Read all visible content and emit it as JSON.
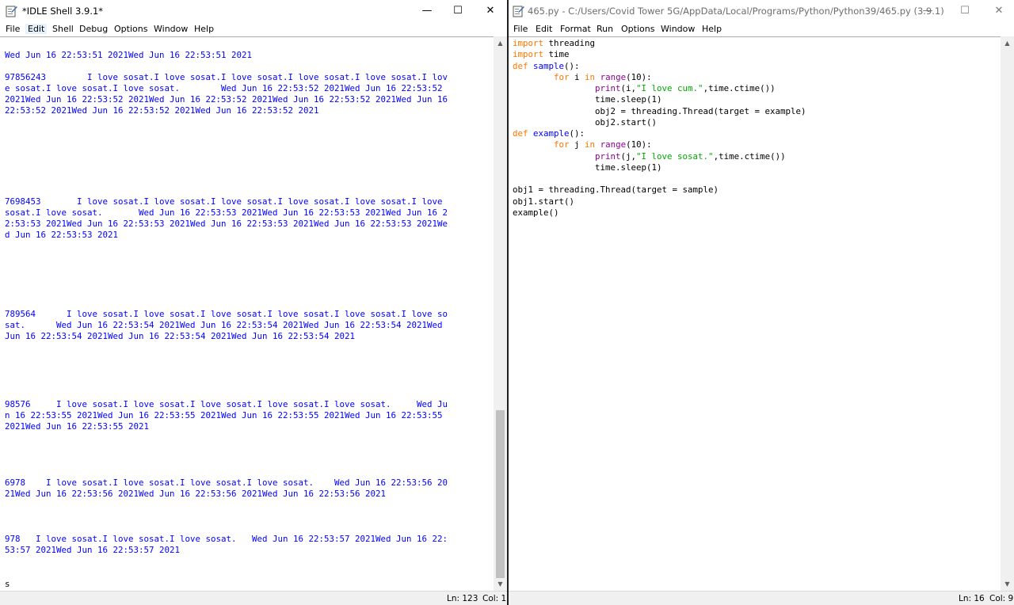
{
  "shell": {
    "title": "*IDLE Shell 3.9.1*",
    "menu": [
      "File",
      "Edit",
      "Shell",
      "Debug",
      "Options",
      "Window",
      "Help"
    ],
    "active_menu": "Edit",
    "output_lines": [
      "Wed Jun 16 22:53:51 2021Wed Jun 16 22:53:51 2021",
      "97856243        I love sosat.I love sosat.I love sosat.I love sosat.I love sosat.I lov",
      "e sosat.I love sosat.I love sosat.        Wed Jun 16 22:53:52 2021Wed Jun 16 22:53:52",
      "2021Wed Jun 16 22:53:52 2021Wed Jun 16 22:53:52 2021Wed Jun 16 22:53:52 2021Wed Jun 16",
      "22:53:52 2021Wed Jun 16 22:53:52 2021Wed Jun 16 22:53:52 2021",
      "7698453       I love sosat.I love sosat.I love sosat.I love sosat.I love sosat.I love",
      "sosat.I love sosat.       Wed Jun 16 22:53:53 2021Wed Jun 16 22:53:53 2021Wed Jun 16 2",
      "2:53:53 2021Wed Jun 16 22:53:53 2021Wed Jun 16 22:53:53 2021Wed Jun 16 22:53:53 2021We",
      "d Jun 16 22:53:53 2021",
      "789564      I love sosat.I love sosat.I love sosat.I love sosat.I love sosat.I love so",
      "sat.      Wed Jun 16 22:53:54 2021Wed Jun 16 22:53:54 2021Wed Jun 16 22:53:54 2021Wed",
      "Jun 16 22:53:54 2021Wed Jun 16 22:53:54 2021Wed Jun 16 22:53:54 2021",
      "98576     I love sosat.I love sosat.I love sosat.I love sosat.I love sosat.     Wed Ju",
      "n 16 22:53:55 2021Wed Jun 16 22:53:55 2021Wed Jun 16 22:53:55 2021Wed Jun 16 22:53:55",
      "2021Wed Jun 16 22:53:55 2021",
      "6978    I love sosat.I love sosat.I love sosat.I love sosat.    Wed Jun 16 22:53:56 20",
      "21Wed Jun 16 22:53:56 2021Wed Jun 16 22:53:56 2021Wed Jun 16 22:53:56 2021",
      "978   I love sosat.I love sosat.I love sosat.   Wed Jun 16 22:53:57 2021Wed Jun 16 22:",
      "53:57 2021Wed Jun 16 22:53:57 2021",
      "s"
    ],
    "status": {
      "line": "Ln: 123",
      "col": "Col: 1"
    }
  },
  "editor": {
    "title": "465.py - C:/Users/Covid Tower 5G/AppData/Local/Programs/Python/Python39/465.py (3.9.1)",
    "menu": [
      "File",
      "Edit",
      "Format",
      "Run",
      "Options",
      "Window",
      "Help"
    ],
    "code_lines": [
      [
        {
          "t": "import",
          "c": "kw"
        },
        {
          "t": " threading",
          "c": "pl"
        }
      ],
      [
        {
          "t": "import",
          "c": "kw"
        },
        {
          "t": " time",
          "c": "pl"
        }
      ],
      [
        {
          "t": "def",
          "c": "kw"
        },
        {
          "t": " ",
          "c": "pl"
        },
        {
          "t": "sample",
          "c": "df"
        },
        {
          "t": "():",
          "c": "pl"
        }
      ],
      [
        {
          "t": "        ",
          "c": "pl"
        },
        {
          "t": "for",
          "c": "kw"
        },
        {
          "t": " i ",
          "c": "pl"
        },
        {
          "t": "in",
          "c": "kw"
        },
        {
          "t": " ",
          "c": "pl"
        },
        {
          "t": "range",
          "c": "bi"
        },
        {
          "t": "(10):",
          "c": "pl"
        }
      ],
      [
        {
          "t": "                ",
          "c": "pl"
        },
        {
          "t": "print",
          "c": "bi"
        },
        {
          "t": "(i,",
          "c": "pl"
        },
        {
          "t": "\"I love cum.\"",
          "c": "st"
        },
        {
          "t": ",time.ctime())",
          "c": "pl"
        }
      ],
      [
        {
          "t": "                time.sleep(1)",
          "c": "pl"
        }
      ],
      [
        {
          "t": "                obj2 = threading.Thread(target = example)",
          "c": "pl"
        }
      ],
      [
        {
          "t": "                obj2.start()",
          "c": "pl"
        }
      ],
      [
        {
          "t": "def",
          "c": "kw"
        },
        {
          "t": " ",
          "c": "pl"
        },
        {
          "t": "example",
          "c": "df"
        },
        {
          "t": "():",
          "c": "pl"
        }
      ],
      [
        {
          "t": "        ",
          "c": "pl"
        },
        {
          "t": "for",
          "c": "kw"
        },
        {
          "t": " j ",
          "c": "pl"
        },
        {
          "t": "in",
          "c": "kw"
        },
        {
          "t": " ",
          "c": "pl"
        },
        {
          "t": "range",
          "c": "bi"
        },
        {
          "t": "(10):",
          "c": "pl"
        }
      ],
      [
        {
          "t": "                ",
          "c": "pl"
        },
        {
          "t": "print",
          "c": "bi"
        },
        {
          "t": "(j,",
          "c": "pl"
        },
        {
          "t": "\"I love sosat.\"",
          "c": "st"
        },
        {
          "t": ",time.ctime())",
          "c": "pl"
        }
      ],
      [
        {
          "t": "                time.sleep(1)",
          "c": "pl"
        }
      ],
      [],
      [
        {
          "t": "obj1 = threading.Thread(target = sample)",
          "c": "pl"
        }
      ],
      [
        {
          "t": "obj1.start()",
          "c": "pl"
        }
      ],
      [
        {
          "t": "example()",
          "c": "pl"
        }
      ]
    ],
    "status": {
      "line": "Ln: 16",
      "col": "Col: 9"
    }
  },
  "window_controls": {
    "minimize": "—",
    "maximize": "☐",
    "close": "✕"
  }
}
